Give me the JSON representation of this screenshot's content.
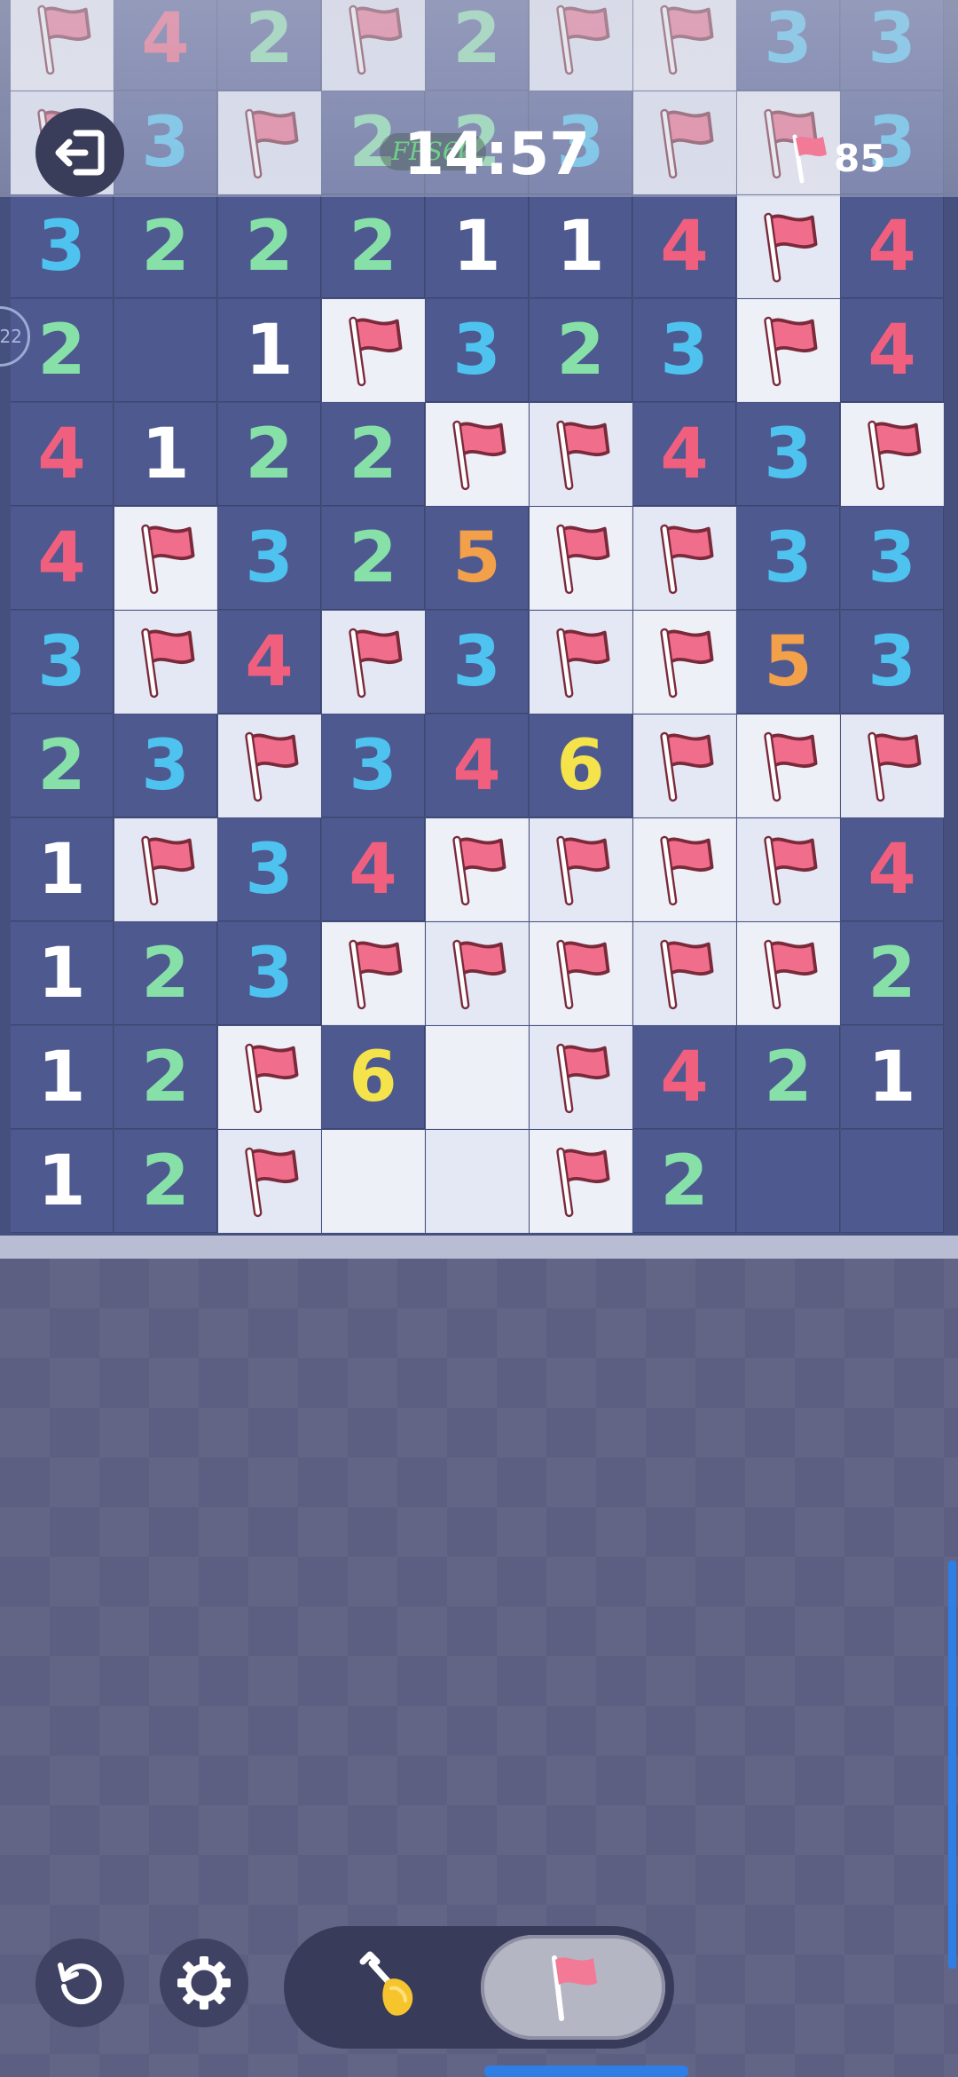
{
  "hud": {
    "timer": "14:57",
    "fps_label": "FPS60",
    "flags_remaining": "85"
  },
  "controls": {
    "exit": "exit-icon",
    "restart": "restart-icon",
    "settings": "gear-icon",
    "dig_mode": "shovel-icon",
    "flag_mode": "flag-icon",
    "active_mode": "flag"
  },
  "colors": {
    "revealed_cell": "#4e5990",
    "hidden_cell": "#eef0f8",
    "flag": "#f06e8c",
    "num_1": "#ffffff",
    "num_2": "#86e0a8",
    "num_3": "#4fc3f0",
    "num_4": "#f0607e",
    "num_5": "#f3a04a",
    "num_6": "#f5e34c"
  },
  "legend": "F = flag, H = hidden empty cell, R = revealed empty cell, digit = revealed number",
  "board": {
    "rows": [
      [
        "F",
        "4",
        "2",
        "F",
        "2",
        "F",
        "F",
        "3",
        "3"
      ],
      [
        "F",
        "3",
        "F",
        "2",
        "2",
        "3",
        "F",
        "F",
        "3"
      ],
      [
        "3",
        "2",
        "2",
        "2",
        "1",
        "1",
        "4",
        "F",
        "4"
      ],
      [
        "2",
        "R",
        "1",
        "F",
        "3",
        "2",
        "3",
        "F",
        "4"
      ],
      [
        "4",
        "1",
        "2",
        "2",
        "F",
        "F",
        "4",
        "3",
        "F"
      ],
      [
        "4",
        "F",
        "3",
        "2",
        "5",
        "F",
        "F",
        "3",
        "3"
      ],
      [
        "3",
        "F",
        "4",
        "F",
        "3",
        "F",
        "F",
        "5",
        "3"
      ],
      [
        "2",
        "3",
        "F",
        "3",
        "4",
        "6",
        "F",
        "F",
        "F"
      ],
      [
        "1",
        "F",
        "3",
        "4",
        "F",
        "F",
        "F",
        "F",
        "4"
      ],
      [
        "1",
        "2",
        "3",
        "F",
        "F",
        "F",
        "F",
        "F",
        "2"
      ],
      [
        "1",
        "2",
        "F",
        "6",
        "H",
        "F",
        "4",
        "2",
        "1"
      ],
      [
        "1",
        "2",
        "F",
        "H",
        "H",
        "F",
        "2",
        "R",
        "R"
      ]
    ]
  }
}
